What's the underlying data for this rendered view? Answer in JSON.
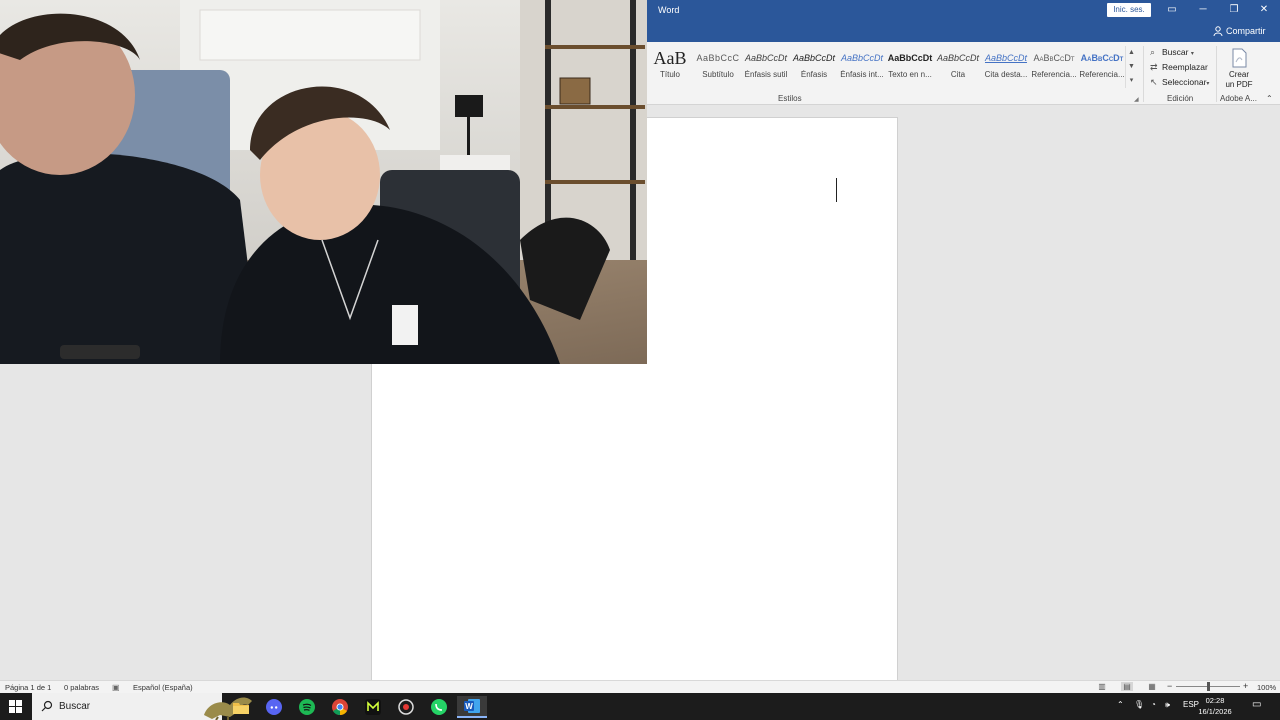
{
  "titlebar": {
    "app_name": "Word",
    "signin_label": "Inic. ses.",
    "controls": [
      "▭",
      "─",
      "❐",
      "✕"
    ]
  },
  "share": {
    "label": "Compartir"
  },
  "styles": {
    "items": [
      {
        "preview": "AaB",
        "name": "Título"
      },
      {
        "preview": "AaBbCcC",
        "name": "Subtítulo"
      },
      {
        "preview": "AaBbCcDt",
        "name": "Énfasis sutil"
      },
      {
        "preview": "AaBbCcDt",
        "name": "Énfasis"
      },
      {
        "preview": "AaBbCcDt",
        "name": "Énfasis int..."
      },
      {
        "preview": "AaBbCcDt",
        "name": "Texto en n..."
      },
      {
        "preview": "AaBbCcDt",
        "name": "Cita"
      },
      {
        "preview": "AaBbCcDt",
        "name": "Cita desta..."
      },
      {
        "preview": "AaBbCcDt",
        "name": "Referencia..."
      },
      {
        "preview": "AaBbCcDt",
        "name": "Referencia..."
      }
    ],
    "group_label": "Estilos"
  },
  "editing": {
    "find": "Buscar",
    "replace": "Reemplazar",
    "select": "Seleccionar",
    "group_label": "Edición"
  },
  "adobe": {
    "line1": "Crear",
    "line2": "un PDF",
    "group_label": "Adobe A..."
  },
  "statusbar": {
    "page": "Página 1 de 1",
    "words": "0 palabras",
    "language": "Español (España)",
    "zoom": "100%"
  },
  "taskbar": {
    "search_placeholder": "Buscar",
    "lang": "ESP",
    "time": "02:28",
    "date": "16/1/2026"
  },
  "colors": {
    "word_blue": "#2b579a",
    "taskbar": "#1c1c1c",
    "ribbon": "#f3f3f3",
    "canvas": "#e6e6e6"
  },
  "zoom_fraction": 0.5
}
